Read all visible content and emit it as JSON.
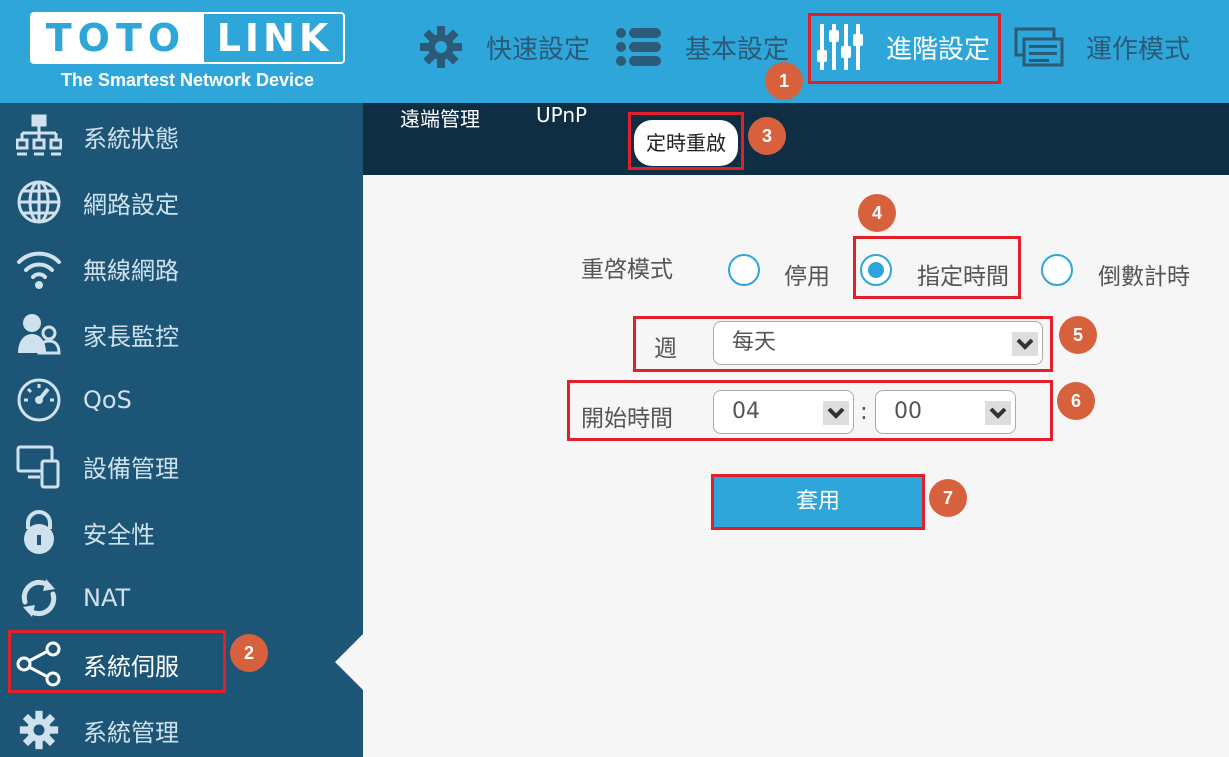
{
  "brand": {
    "logo_left": "TOTO",
    "logo_right": "LINK",
    "tagline": "The Smartest Network Device"
  },
  "topnav": [
    {
      "label": "快速設定",
      "icon": "gear-icon"
    },
    {
      "label": "基本設定",
      "icon": "list-icon"
    },
    {
      "label": "進階設定",
      "icon": "sliders-icon"
    },
    {
      "label": "運作模式",
      "icon": "mode-icon"
    }
  ],
  "sidebar": {
    "items": [
      {
        "label": "系統狀態",
        "icon": "network-status-icon"
      },
      {
        "label": "網路設定",
        "icon": "globe-icon"
      },
      {
        "label": "無線網路",
        "icon": "wifi-icon"
      },
      {
        "label": "家長監控",
        "icon": "parental-icon"
      },
      {
        "label": "QoS",
        "icon": "gauge-icon"
      },
      {
        "label": "設備管理",
        "icon": "devices-icon"
      },
      {
        "label": "安全性",
        "icon": "lock-icon"
      },
      {
        "label": "NAT",
        "icon": "refresh-icon"
      },
      {
        "label": "系統伺服",
        "icon": "share-icon"
      },
      {
        "label": "系統管理",
        "icon": "gear-icon"
      }
    ]
  },
  "tabs": [
    {
      "label": "遠端管理"
    },
    {
      "label": "UPnP"
    },
    {
      "label": "定時重啟"
    }
  ],
  "form": {
    "reboot_mode_label": "重啓模式",
    "reboot_mode_options": [
      "停用",
      "指定時間",
      "倒數計時"
    ],
    "reboot_mode_selected": "指定時間",
    "week_label": "週",
    "week_value": "每天",
    "start_time_label": "開始時間",
    "hour_value": "04",
    "minute_value": "00",
    "time_separator": ":",
    "apply_label": "套用"
  },
  "annotations": [
    "1",
    "2",
    "3",
    "4",
    "5",
    "6",
    "7"
  ],
  "colors": {
    "accent": "#2fa6d9",
    "sidebar": "#1d5577",
    "tabbar": "#0f2e44",
    "highlight": "#e0202a",
    "badge": "#d7613d"
  }
}
